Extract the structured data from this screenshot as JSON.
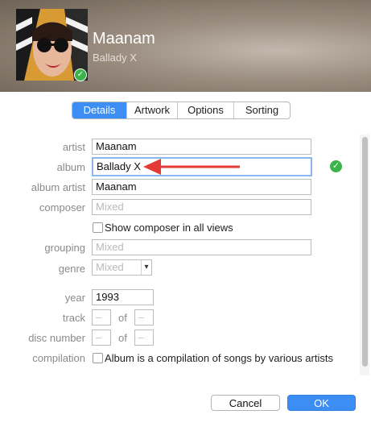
{
  "header": {
    "title": "Maanam",
    "subtitle": "Ballady X"
  },
  "tabs": [
    "Details",
    "Artwork",
    "Options",
    "Sorting"
  ],
  "labels": {
    "artist": "artist",
    "album": "album",
    "album_artist": "album artist",
    "composer": "composer",
    "grouping": "grouping",
    "genre": "genre",
    "year": "year",
    "track": "track",
    "disc_number": "disc number",
    "compilation": "compilation",
    "of": "of"
  },
  "fields": {
    "artist": "Maanam",
    "album": "Ballady X",
    "album_artist": "Maanam",
    "composer_placeholder": "Mixed",
    "grouping_placeholder": "Mixed",
    "genre_placeholder": "Mixed",
    "year": "1993",
    "track_number": "–",
    "track_total": "–",
    "disc_number": "–",
    "disc_total": "–"
  },
  "checkboxes": {
    "show_composer": "Show composer in all views",
    "compilation": "Album is a compilation of songs by various artists"
  },
  "buttons": {
    "cancel": "Cancel",
    "ok": "OK"
  },
  "colors": {
    "accent": "#3d8ef4",
    "arrow": "#e53935",
    "check": "#3bb34a"
  }
}
